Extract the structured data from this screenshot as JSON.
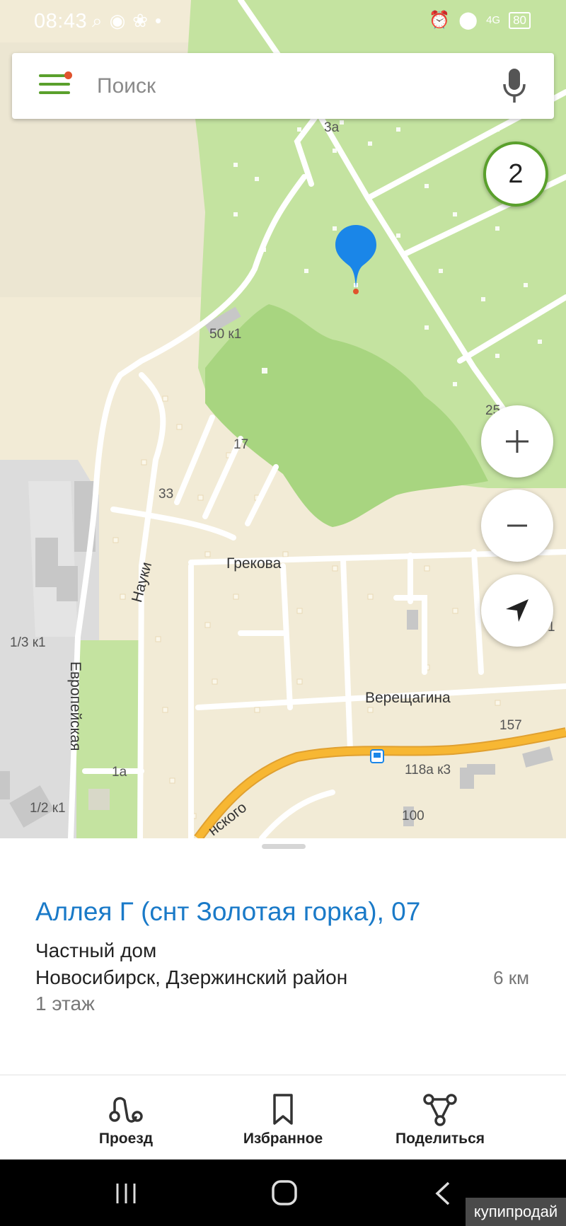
{
  "status_bar": {
    "time": "08:43",
    "network": "4G",
    "battery": "80",
    "left_icons": [
      "search-icon",
      "sberbank-icon",
      "paw-icon",
      "dot-icon"
    ],
    "right_icons": [
      "alarm-icon",
      "location-icon",
      "network-icon",
      "battery-icon"
    ]
  },
  "search": {
    "placeholder": "Поиск",
    "value": "",
    "menu_icon": "hamburger-icon",
    "mic_icon": "microphone-icon",
    "notification_color": "#e0532d"
  },
  "map": {
    "results_count": "2",
    "building_labels": [
      "3а",
      "50 к1",
      "17",
      "33",
      "25",
      "1/3 к1",
      "1а",
      "1/2 к1",
      "157",
      "118а к3",
      "100",
      "1"
    ],
    "street_labels": [
      "Грекова",
      "Науки",
      "Европейская",
      "Верещагина",
      "нского"
    ],
    "controls": [
      "zoom-in-icon",
      "zoom-out-icon",
      "my-location-icon"
    ],
    "pin_color": "#1a86e8",
    "highway_color": "#f5a623"
  },
  "card": {
    "title": "Аллея Г (снт Золотая горка), 07",
    "type": "Частный дом",
    "address": "Новосибирск, Дзержинский район",
    "distance": "6 км",
    "floors": "1 этаж"
  },
  "actions": [
    {
      "label": "Проезд",
      "icon": "route-icon"
    },
    {
      "label": "Избранное",
      "icon": "bookmark-icon"
    },
    {
      "label": "Поделиться",
      "icon": "share-icon"
    }
  ],
  "nav": [
    "recents-icon",
    "home-icon",
    "back-icon"
  ],
  "watermark": "купипродай",
  "colors": {
    "accent_green": "#5aa02c",
    "link_blue": "#1a7ac8",
    "park_green": "#c4e3a0",
    "forest_green": "#a8d580",
    "residential": "#f1ead7"
  }
}
